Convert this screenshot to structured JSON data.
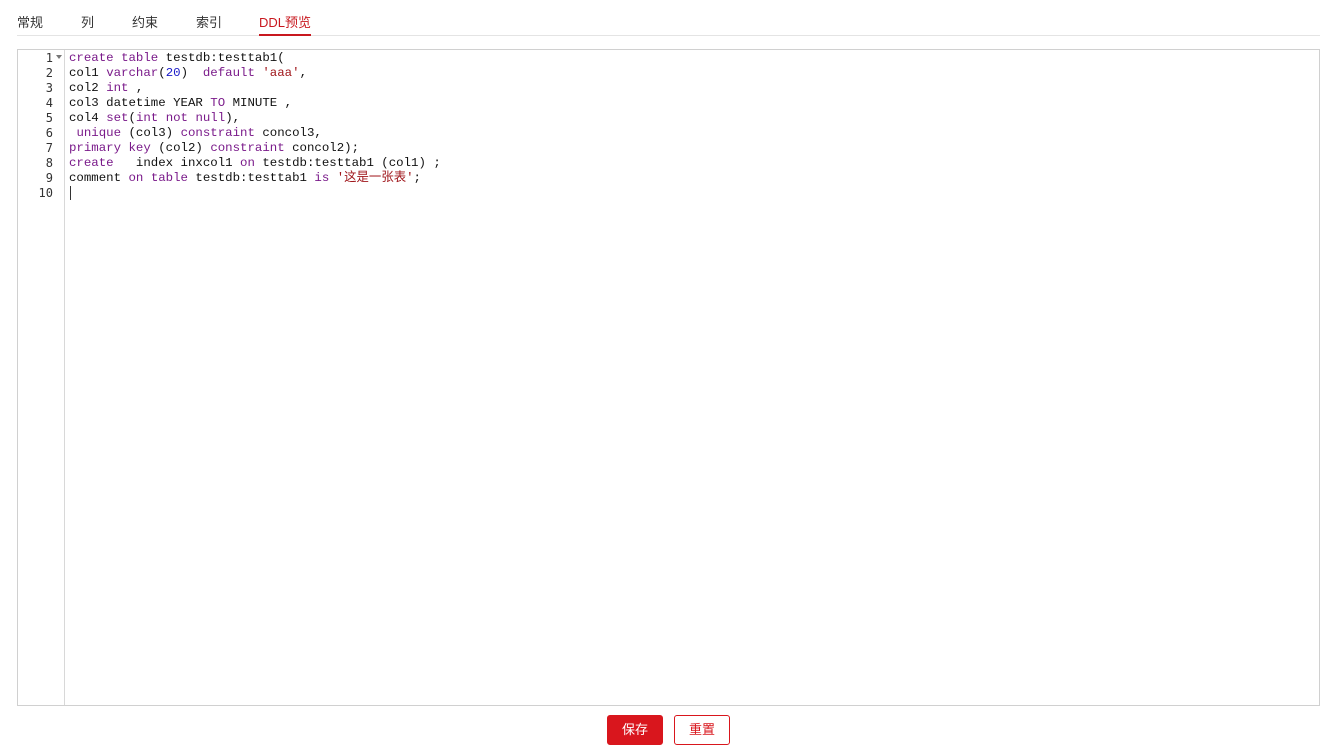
{
  "tabs": [
    {
      "label": "常规"
    },
    {
      "label": "列"
    },
    {
      "label": "约束"
    },
    {
      "label": "索引"
    },
    {
      "label": "DDL预览",
      "active": true
    }
  ],
  "editor": {
    "line_numbers": [
      "1",
      "2",
      "3",
      "4",
      "5",
      "6",
      "7",
      "8",
      "9",
      "10"
    ],
    "lines": [
      [
        {
          "t": "create",
          "c": "kw"
        },
        {
          "t": " "
        },
        {
          "t": "table",
          "c": "kw"
        },
        {
          "t": " testdb:testtab1("
        }
      ],
      [
        {
          "t": "col1 "
        },
        {
          "t": "varchar",
          "c": "kw"
        },
        {
          "t": "("
        },
        {
          "t": "20",
          "c": "num"
        },
        {
          "t": ")  "
        },
        {
          "t": "default",
          "c": "kw"
        },
        {
          "t": " "
        },
        {
          "t": "'aaa'",
          "c": "str"
        },
        {
          "t": ","
        }
      ],
      [
        {
          "t": "col2 "
        },
        {
          "t": "int",
          "c": "kw"
        },
        {
          "t": " ,"
        }
      ],
      [
        {
          "t": "col3 datetime YEAR "
        },
        {
          "t": "TO",
          "c": "kw"
        },
        {
          "t": " MINUTE ,"
        }
      ],
      [
        {
          "t": "col4 "
        },
        {
          "t": "set",
          "c": "kw"
        },
        {
          "t": "("
        },
        {
          "t": "int",
          "c": "kw"
        },
        {
          "t": " "
        },
        {
          "t": "not",
          "c": "kw"
        },
        {
          "t": " "
        },
        {
          "t": "null",
          "c": "kw"
        },
        {
          "t": "),"
        }
      ],
      [
        {
          "t": " "
        },
        {
          "t": "unique",
          "c": "kw"
        },
        {
          "t": " (col3) "
        },
        {
          "t": "constraint",
          "c": "kw"
        },
        {
          "t": " concol3,"
        }
      ],
      [
        {
          "t": "primary",
          "c": "kw"
        },
        {
          "t": " "
        },
        {
          "t": "key",
          "c": "kw"
        },
        {
          "t": " (col2) "
        },
        {
          "t": "constraint",
          "c": "kw"
        },
        {
          "t": " concol2);"
        }
      ],
      [
        {
          "t": "create",
          "c": "kw"
        },
        {
          "t": "   index inxcol1 "
        },
        {
          "t": "on",
          "c": "kw"
        },
        {
          "t": " testdb:testtab1 (col1) ;"
        }
      ],
      [
        {
          "t": "comment "
        },
        {
          "t": "on",
          "c": "kw"
        },
        {
          "t": " "
        },
        {
          "t": "table",
          "c": "kw"
        },
        {
          "t": " testdb:testtab1 "
        },
        {
          "t": "is",
          "c": "kw"
        },
        {
          "t": " "
        },
        {
          "t": "'这是一张表'",
          "c": "str"
        },
        {
          "t": ";"
        }
      ],
      []
    ]
  },
  "buttons": {
    "save_label": "保存",
    "reset_label": "重置"
  },
  "colors": {
    "accent": "#d9161d",
    "keyword": "#7a1a8a",
    "number": "#1a1ac8",
    "string": "#a0171c"
  },
  "icons": {
    "fold": "chevron-down-icon"
  }
}
